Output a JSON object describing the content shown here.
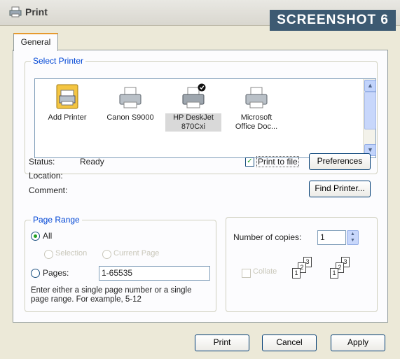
{
  "window": {
    "title": "Print",
    "badge": "SCREENSHOT 6"
  },
  "tabs": [
    {
      "label": "General"
    }
  ],
  "select_printer": {
    "label": "Select Printer",
    "printers": [
      {
        "name": "Add Printer",
        "icon": "add-printer-icon"
      },
      {
        "name": "Canon S9000",
        "icon": "printer-icon"
      },
      {
        "name": "HP DeskJet 870Cxi",
        "icon": "printer-icon",
        "selected": true
      },
      {
        "name": "Microsoft Office Doc...",
        "icon": "printer-icon"
      }
    ]
  },
  "printer_info": {
    "status_label": "Status:",
    "status_value": "Ready",
    "location_label": "Location:",
    "comment_label": "Comment:",
    "print_to_file": "Print to file",
    "print_to_file_checked": true,
    "preferences_button": "Preferences",
    "find_printer_button": "Find Printer..."
  },
  "page_range": {
    "label": "Page Range",
    "all": "All",
    "selection": "Selection",
    "current_page": "Current Page",
    "pages": "Pages:",
    "pages_value": "1-65535",
    "hint": "Enter either a single page number or a single page range.  For example, 5-12"
  },
  "copies": {
    "label": "Number of copies:",
    "value": "1",
    "collate": "Collate"
  },
  "footer": {
    "print": "Print",
    "cancel": "Cancel",
    "apply": "Apply"
  },
  "colors": {
    "group_label": "#0046d5",
    "tab_accent": "#e69a2e",
    "check": "#21a121"
  }
}
